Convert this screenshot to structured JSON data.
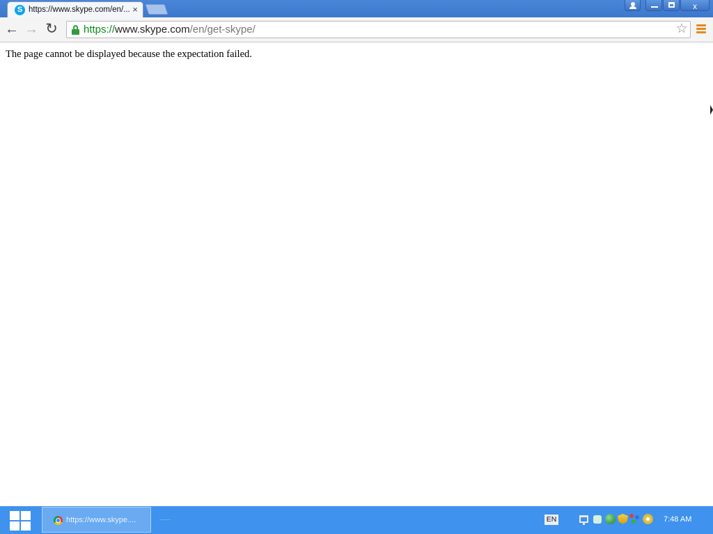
{
  "browser": {
    "tab": {
      "title": "https://www.skype.com/en/...",
      "favicon_letter": "S",
      "close_glyph": "×"
    },
    "window_controls": {
      "close_glyph": "x"
    },
    "nav": {
      "back_glyph": "←",
      "forward_glyph": "→",
      "reload_glyph": "↻"
    },
    "address_bar": {
      "scheme": "https://",
      "host": "www.skype.com",
      "path": "/en/get-skype/",
      "star_glyph": "☆"
    }
  },
  "page": {
    "message": "The page cannot be displayed because the expectation failed."
  },
  "taskbar": {
    "task_label": "https://www.skype....",
    "language": "EN",
    "clock": "7:48 AM"
  },
  "colors": {
    "titlebar": "#3b77cc",
    "taskbar": "#3f92ed",
    "url_secure": "#0b8a1c",
    "menu_accent": "#e6881a"
  },
  "icons": [
    "windows-logo-icon",
    "chrome-icon",
    "lock-icon",
    "star-icon",
    "menu-icon",
    "network-icon",
    "speaker-icon",
    "globe-icon",
    "shield-icon",
    "molecule-icon",
    "disc-icon"
  ]
}
